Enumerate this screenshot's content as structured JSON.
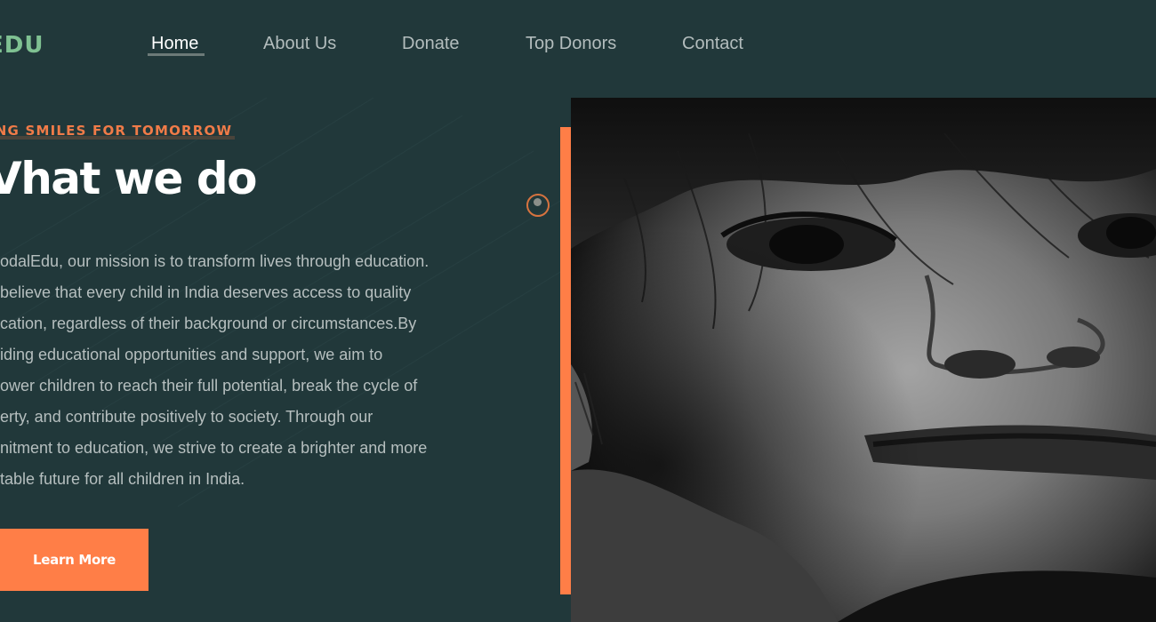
{
  "header": {
    "logo": "EDU",
    "nav": [
      {
        "label": "Home",
        "active": true
      },
      {
        "label": "About Us",
        "active": false
      },
      {
        "label": "Donate",
        "active": false
      },
      {
        "label": "Top Donors",
        "active": false
      },
      {
        "label": "Contact",
        "active": false
      }
    ]
  },
  "hero": {
    "tagline": "ING SMILES FOR TOMORROW",
    "headline": "Vhat we do",
    "body_lines": [
      "odalEdu, our mission is to transform lives through education.",
      "believe that every child in India deserves access to quality",
      "cation, regardless of their background or circumstances.By",
      "iding educational opportunities and support, we aim to",
      "ower children to reach their full potential, break the cycle of",
      "erty, and contribute positively to society. Through our",
      "nitment to education, we strive to create a brighter and more",
      "table future for all children in India."
    ],
    "cta_label": "Learn More"
  },
  "colors": {
    "background": "#21383a",
    "accent": "#ff7e47",
    "logo": "#7fc192",
    "text_muted": "#b6bfbf"
  },
  "icons": {
    "carousel_indicator": "circle-dot-icon"
  }
}
